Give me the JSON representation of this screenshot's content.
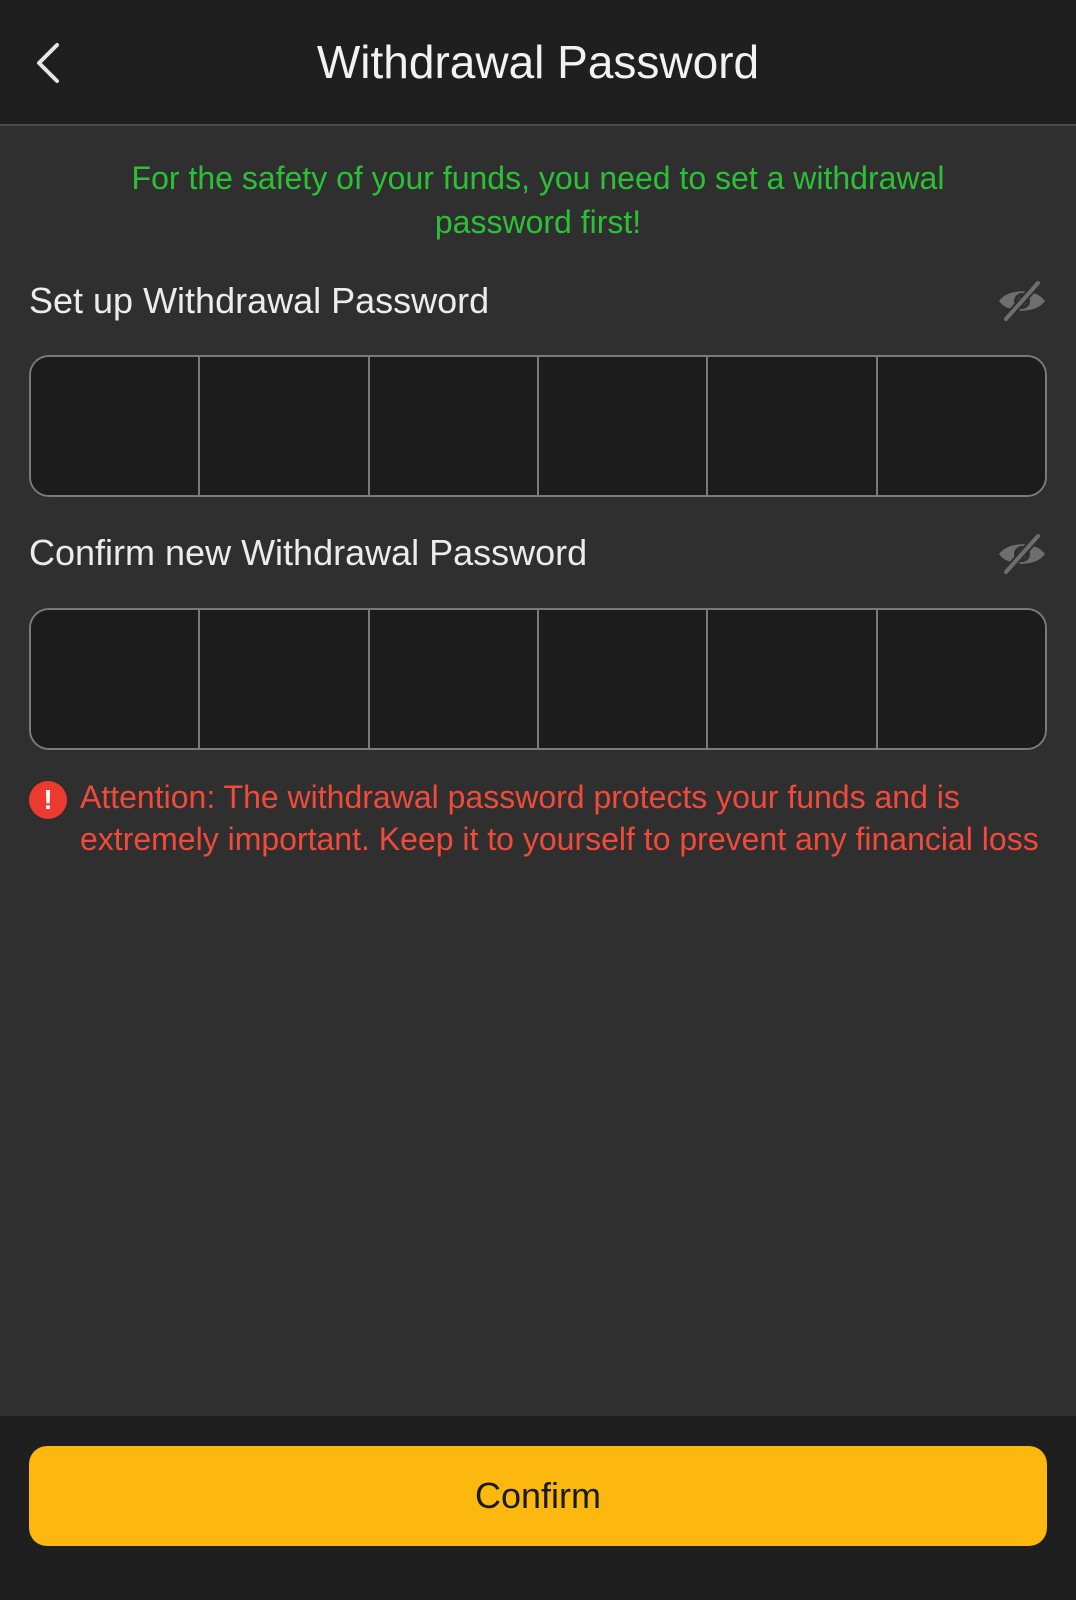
{
  "header": {
    "title": "Withdrawal Password",
    "back_icon": "chevron-left-icon"
  },
  "notice": "For the safety of your funds, you need to set a withdrawal password first!",
  "fields": {
    "setup": {
      "label": "Set up Withdrawal Password",
      "visibility_icon": "eye-off-icon",
      "digit_count": 6
    },
    "confirm": {
      "label": "Confirm new Withdrawal Password",
      "visibility_icon": "eye-off-icon",
      "digit_count": 6
    }
  },
  "warning": {
    "icon": "exclamation-icon",
    "text": "Attention: The withdrawal password protects your funds and is extremely important. Keep it to yourself to prevent any financial loss"
  },
  "footer": {
    "confirm_label": "Confirm"
  },
  "colors": {
    "accent": "#fcb80e",
    "notice_green": "#2bc137",
    "warning_red": "#f04b3a",
    "background": "#2f2f2f",
    "header": "#1f1f1f"
  }
}
